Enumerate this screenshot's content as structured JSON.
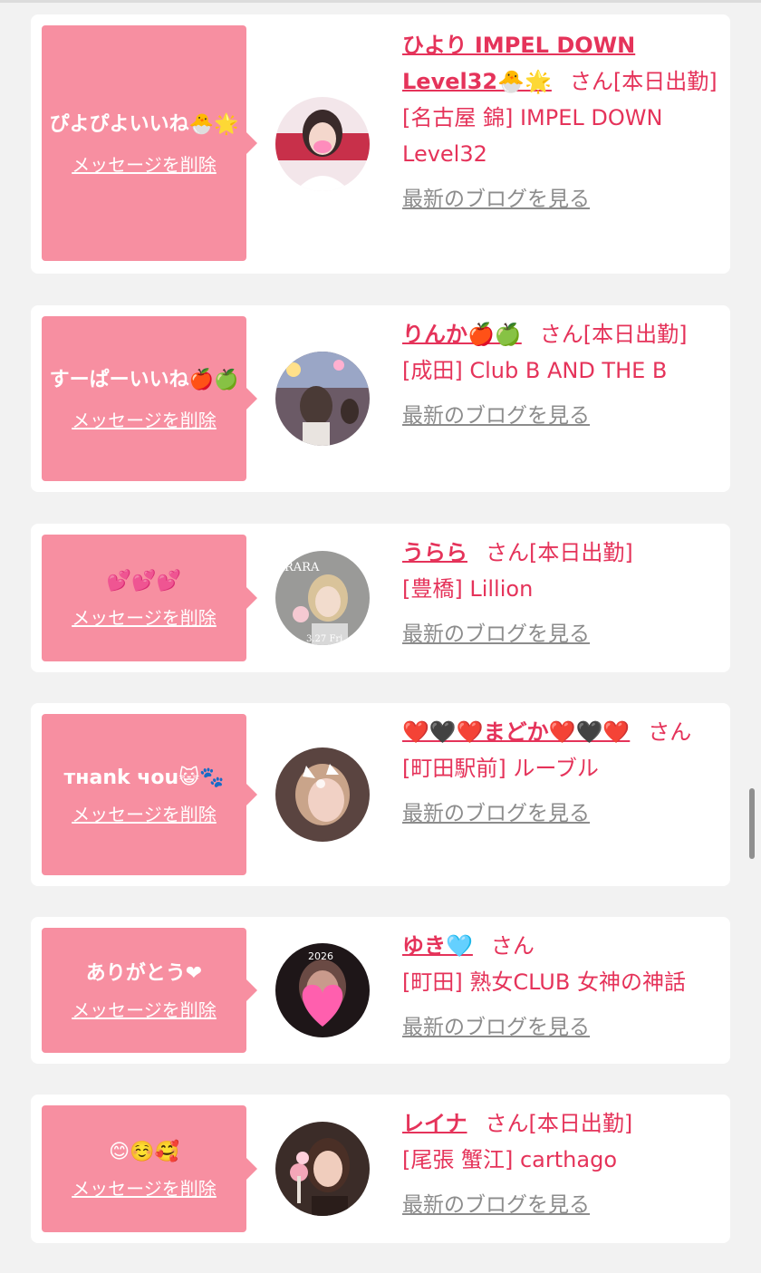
{
  "items": [
    {
      "message": "ぴよぴよいいね🐣🌟",
      "delete_label": "メッセージを削除",
      "name": "ひより IMPEL DOWN Level32🐣🌟",
      "suffix": "さん[本日出勤]",
      "shop": "[名古屋 錦] IMPEL DOWN Level32",
      "blog_label": "最新のブログを見る"
    },
    {
      "message": "すーぱーいいね🍎🍏",
      "delete_label": "メッセージを削除",
      "name": "りんか🍎🍏",
      "suffix": "さん[本日出勤]",
      "shop": "[成田] Club B AND THE B",
      "blog_label": "最新のブログを見る"
    },
    {
      "message": "💕💕💕",
      "delete_label": "メッセージを削除",
      "name": "うらら",
      "suffix": "さん[本日出勤]",
      "shop": "[豊橋] Lillion",
      "blog_label": "最新のブログを見る",
      "avatar_text_top": "RARA",
      "avatar_text_bottom": "3.27 Fri"
    },
    {
      "message": "тнank чou😺🐾",
      "delete_label": "メッセージを削除",
      "name": "❤️🖤❤️まどか❤️🖤❤️",
      "suffix": "さん",
      "shop": "[町田駅前] ルーブル",
      "blog_label": "最新のブログを見る"
    },
    {
      "message": "ありがとう❤",
      "delete_label": "メッセージを削除",
      "name": "ゆき🩵",
      "suffix": "さん",
      "shop": "[町田] 熟女CLUB 女神の神話",
      "blog_label": "最新のブログを見る",
      "avatar_text_top": "2026"
    },
    {
      "message": "😊☺️🥰",
      "delete_label": "メッセージを削除",
      "name": "レイナ",
      "suffix": "さん[本日出勤]",
      "shop": "[尾張 蟹江] carthago",
      "blog_label": "最新のブログを見る"
    }
  ]
}
